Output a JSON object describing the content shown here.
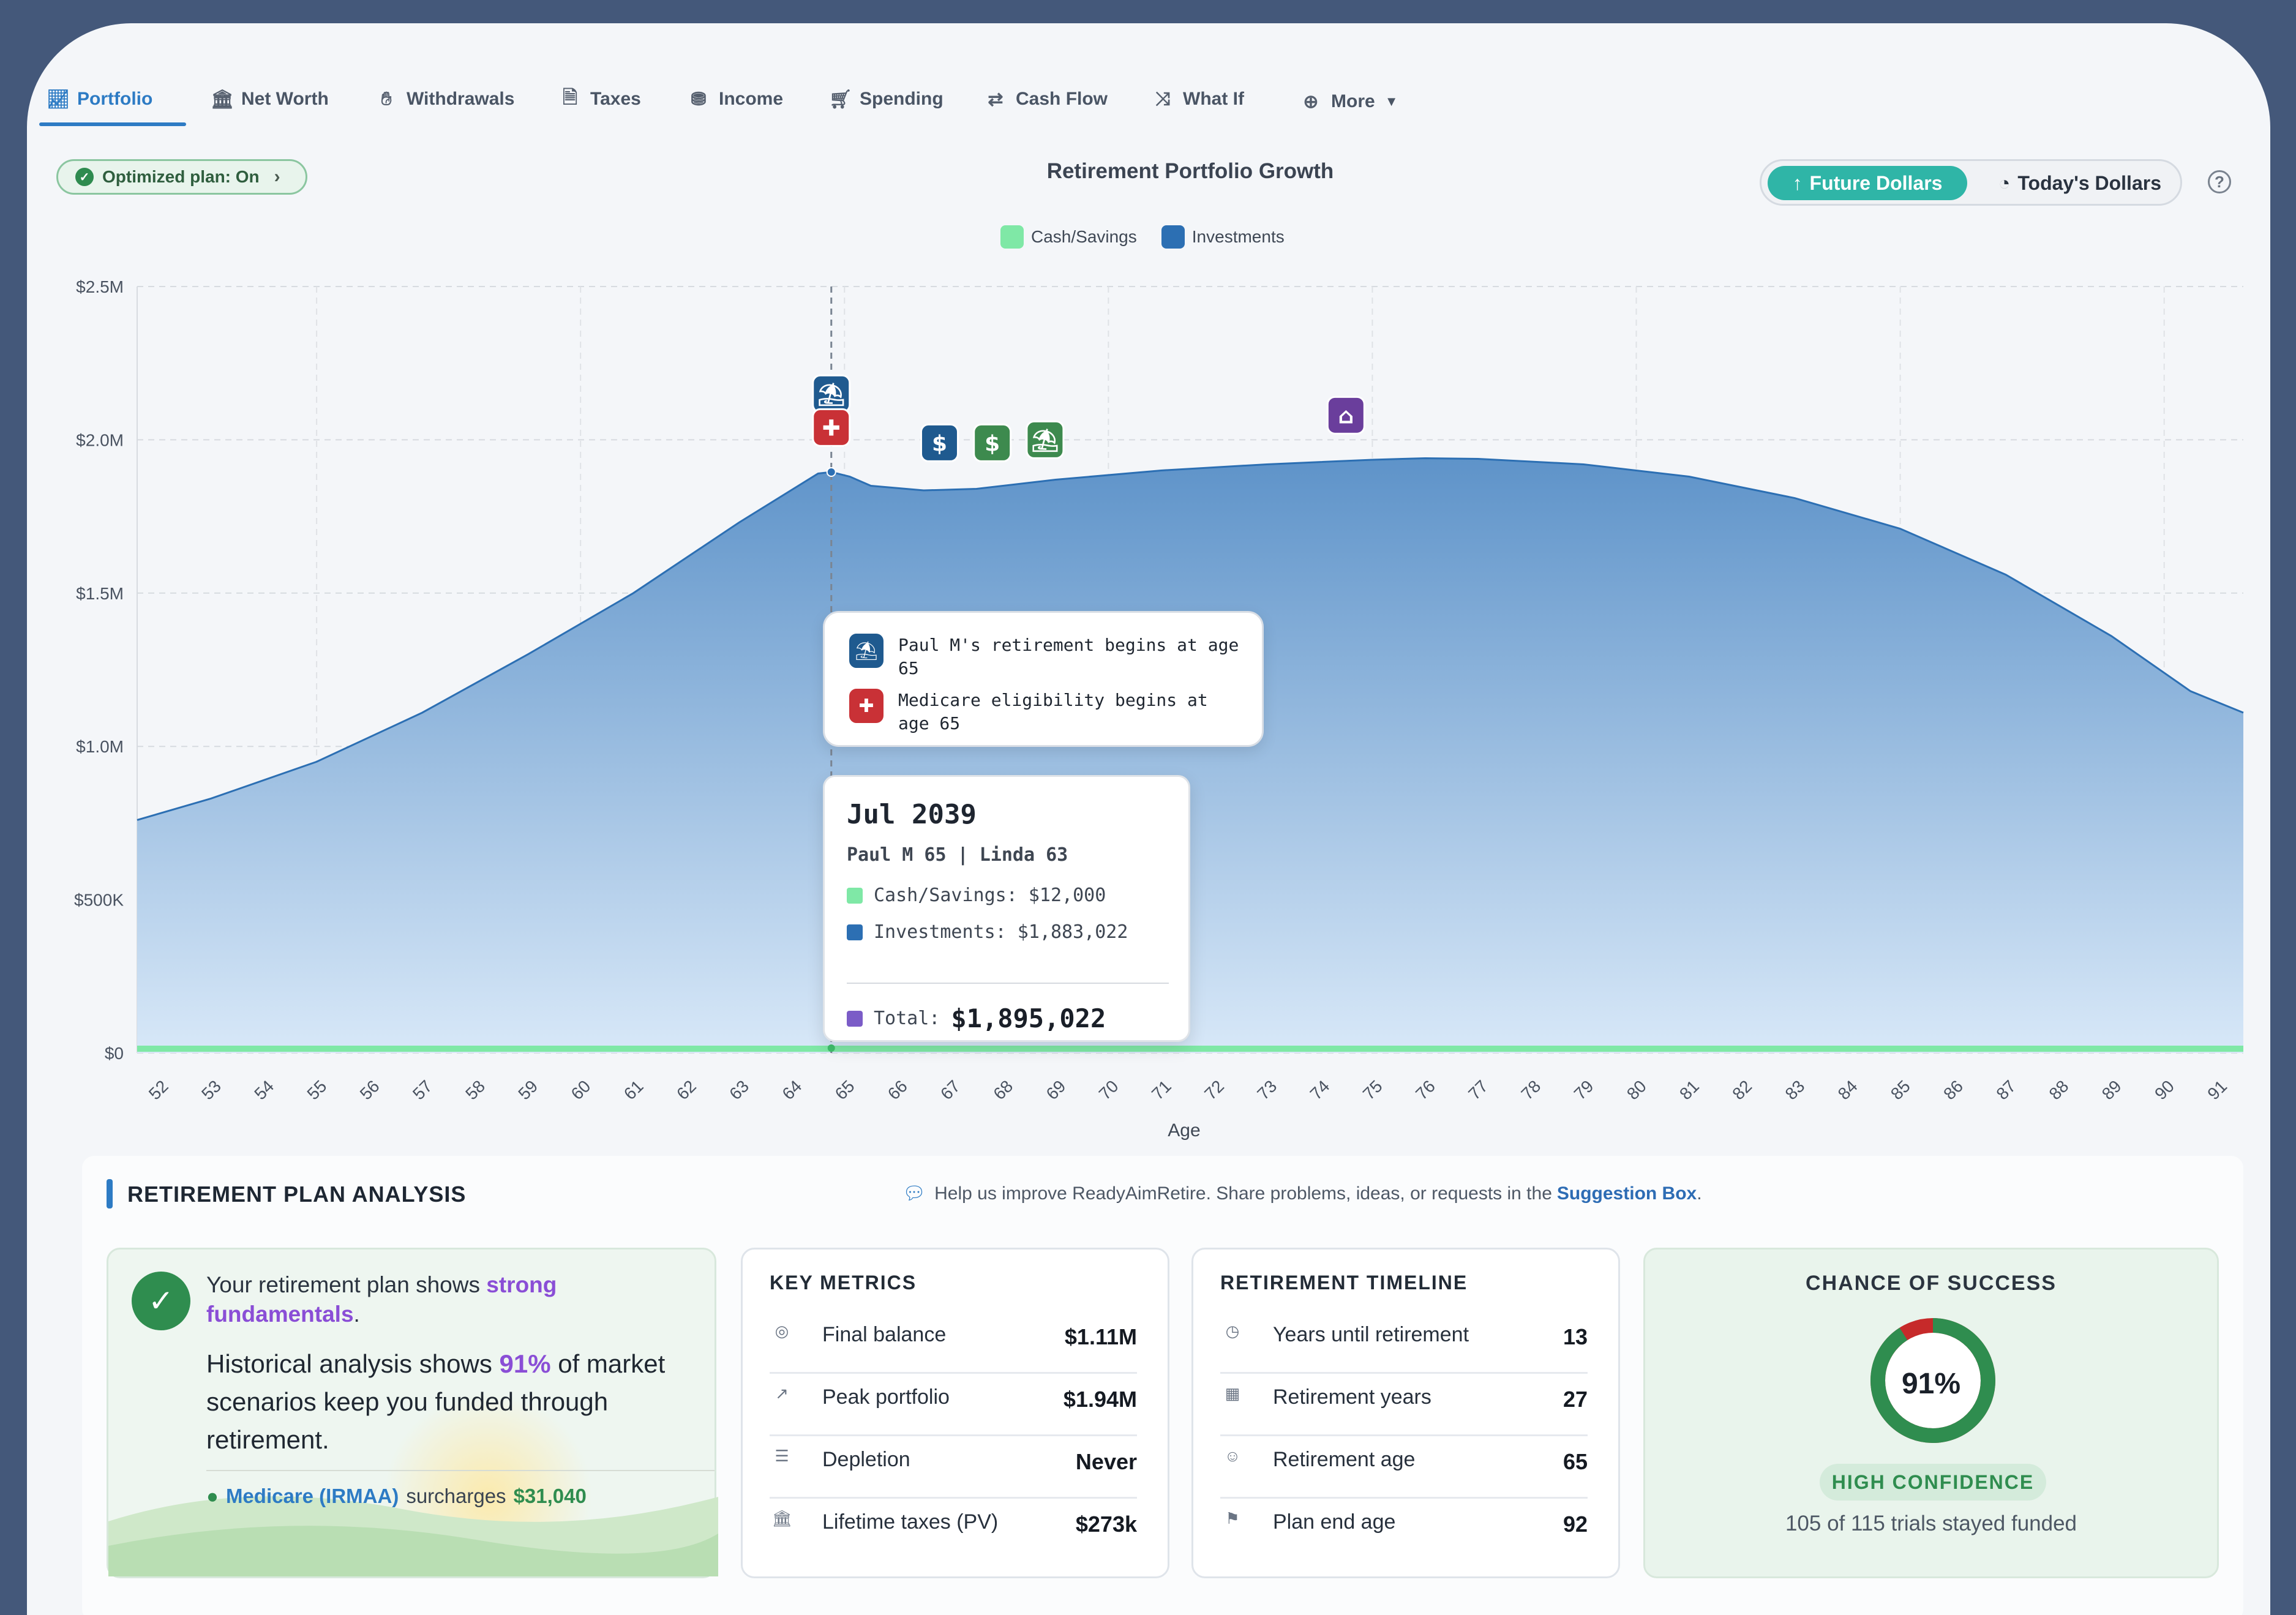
{
  "nav": {
    "tabs": [
      {
        "label": "Portfolio",
        "icon": "chart-line-icon"
      },
      {
        "label": "Net Worth",
        "icon": "bank-icon"
      },
      {
        "label": "Withdrawals",
        "icon": "hand-coin-icon"
      },
      {
        "label": "Taxes",
        "icon": "receipt-icon"
      },
      {
        "label": "Income",
        "icon": "coins-icon"
      },
      {
        "label": "Spending",
        "icon": "cart-icon"
      },
      {
        "label": "Cash Flow",
        "icon": "arrows-swap-icon"
      },
      {
        "label": "What If",
        "icon": "shuffle-icon"
      },
      {
        "label": "More",
        "icon": "plus-circle-icon"
      }
    ],
    "active": "Portfolio"
  },
  "controls": {
    "optimized_label": "Optimized plan: On",
    "future_label": "Future Dollars",
    "today_label": "Today's Dollars",
    "help": "?"
  },
  "chart_data": {
    "type": "area",
    "title": "Retirement Portfolio Growth",
    "xlabel": "Age",
    "ylabel": "",
    "ylim": [
      0,
      2500000
    ],
    "y_ticks": [
      "$0",
      "$500K",
      "$1.0M",
      "$1.5M",
      "$2.0M",
      "$2.5M"
    ],
    "x": [
      52,
      53,
      54,
      55,
      56,
      57,
      58,
      59,
      60,
      61,
      62,
      63,
      64,
      65,
      66,
      67,
      68,
      69,
      70,
      71,
      72,
      73,
      74,
      75,
      76,
      77,
      78,
      79,
      80,
      81,
      82,
      83,
      84,
      85,
      86,
      87,
      88,
      89,
      90,
      91
    ],
    "x_range": [
      51.6,
      91.5
    ],
    "legend": "top-center",
    "grid": true,
    "series": [
      {
        "name": "Cash/Savings",
        "color": "#7fe8a6",
        "points": [
          [
            51.6,
            12000
          ],
          [
            91.5,
            12000
          ]
        ]
      },
      {
        "name": "Investments",
        "color": "#2c6fb3",
        "points": [
          [
            51.6,
            760000
          ],
          [
            53,
            830000
          ],
          [
            55,
            950000
          ],
          [
            57,
            1110000
          ],
          [
            59,
            1300000
          ],
          [
            61,
            1500000
          ],
          [
            63,
            1730000
          ],
          [
            64.5,
            1890000
          ],
          [
            64.75,
            1895022
          ],
          [
            65.1,
            1880000
          ],
          [
            65.5,
            1850000
          ],
          [
            66.5,
            1835000
          ],
          [
            67.5,
            1840000
          ],
          [
            69,
            1870000
          ],
          [
            71,
            1900000
          ],
          [
            73,
            1920000
          ],
          [
            75,
            1935000
          ],
          [
            76,
            1940000
          ],
          [
            77,
            1938000
          ],
          [
            79,
            1920000
          ],
          [
            81,
            1880000
          ],
          [
            83,
            1810000
          ],
          [
            85,
            1710000
          ],
          [
            87,
            1560000
          ],
          [
            89,
            1360000
          ],
          [
            90.5,
            1180000
          ],
          [
            91.5,
            1110000
          ]
        ]
      }
    ],
    "marker_age": 64.75,
    "events": [
      {
        "age": 64.75,
        "amount": 2150000,
        "icon": "beach-umbrella-icon",
        "color": "#1f5a8f"
      },
      {
        "age": 64.75,
        "amount": 2040000,
        "icon": "medical-kit-icon",
        "color": "#c93136"
      },
      {
        "age": 66.8,
        "amount": 1990000,
        "icon": "dollar-icon",
        "color": "#1f5a8f"
      },
      {
        "age": 67.8,
        "amount": 1990000,
        "icon": "dollar-icon",
        "color": "#3d8a4e"
      },
      {
        "age": 68.8,
        "amount": 2000000,
        "icon": "beach-umbrella-icon",
        "color": "#3d8a4e"
      },
      {
        "age": 74.5,
        "amount": 2080000,
        "icon": "bank-icon",
        "color": "#6a3e9c"
      }
    ]
  },
  "legend_items": [
    {
      "label": "Cash/Savings",
      "color": "#7fe8a6"
    },
    {
      "label": "Investments",
      "color": "#2c6fb3"
    }
  ],
  "event_tooltip": {
    "items": [
      {
        "text": "Paul M's retirement begins at age 65",
        "icon": "beach-umbrella-icon",
        "color": "#1f5a8f"
      },
      {
        "text": "Medicare eligibility begins at age 65",
        "icon": "medical-kit-icon",
        "color": "#c93136"
      }
    ]
  },
  "data_tooltip": {
    "date": "Jul 2039",
    "people": "Paul M 65 | Linda 63",
    "cash": "Cash/Savings: $12,000",
    "investments": "Investments: $1,883,022",
    "total_label": "Total:",
    "total_value": "$1,895,022",
    "cash_color": "#7fe8a6",
    "inv_color": "#2c6fb3",
    "total_color": "#7b5cc7"
  },
  "analysis": {
    "title": "RETIREMENT PLAN ANALYSIS",
    "help_text": "Help us improve ReadyAimRetire. Share problems, ideas, or requests in the",
    "suggestion": "Suggestion Box",
    "period": ".",
    "summary": {
      "pre": "Your retirement plan shows",
      "strong": "strong fundamentals",
      "post": ".",
      "hist_pre": "Historical analysis shows",
      "hist_pct": "91%",
      "hist_post": "of market scenarios keep you funded through retirement.",
      "irmaa_link": "Medicare (IRMAA)",
      "irmaa_text": "surcharges",
      "irmaa_amt": "$31,040"
    },
    "key_metrics": {
      "title": "KEY METRICS",
      "rows": [
        {
          "icon": "money-bag-icon",
          "label": "Final balance",
          "value": "$1.11M"
        },
        {
          "icon": "trend-up-icon",
          "label": "Peak portfolio",
          "value": "$1.94M"
        },
        {
          "icon": "document-icon",
          "label": "Depletion",
          "value": "Never"
        },
        {
          "icon": "bank-icon",
          "label": "Lifetime taxes (PV)",
          "value": "$273k"
        }
      ]
    },
    "timeline": {
      "title": "RETIREMENT TIMELINE",
      "rows": [
        {
          "icon": "clock-icon",
          "label": "Years until retirement",
          "value": "13"
        },
        {
          "icon": "calendar-icon",
          "label": "Retirement years",
          "value": "27"
        },
        {
          "icon": "person-icon",
          "label": "Retirement age",
          "value": "65"
        },
        {
          "icon": "flag-icon",
          "label": "Plan end age",
          "value": "92"
        }
      ]
    },
    "success": {
      "title": "CHANCE OF SUCCESS",
      "percent": "91%",
      "fraction": 0.91,
      "badge": "HIGH CONFIDENCE",
      "trials": "105 of 115 trials stayed funded",
      "ring_color": "#2f8d4f",
      "fail_color": "#c62a2a"
    }
  }
}
